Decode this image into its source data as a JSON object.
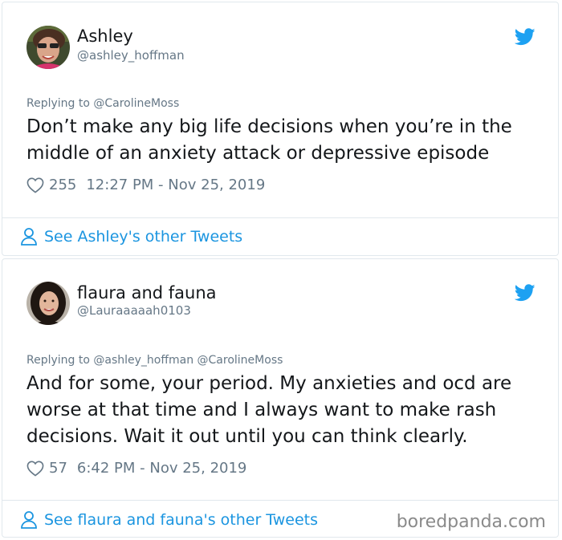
{
  "colors": {
    "text": "#14171a",
    "secondary": "#657786",
    "link": "#1b95e0",
    "twitter_blue": "#1da1f2",
    "border": "#e1e8ed"
  },
  "tweets": [
    {
      "name": "Ashley",
      "handle": "@ashley_hoffman",
      "replying_to": "Replying to @CarolineMoss",
      "text": "Don’t make any big life decisions when you’re in the middle of an anxiety attack or depressive episode",
      "likes": "255",
      "timestamp": "12:27 PM - Nov 25, 2019",
      "see_more": "See Ashley's other Tweets"
    },
    {
      "name": "flaura and fauna",
      "handle": "@Lauraaaaah0103",
      "replying_to": "Replying to @ashley_hoffman @CarolineMoss",
      "text": "And for some, your period. My anxieties and ocd are worse at that time and I always want to make rash decisions. Wait it out until you can think clearly.",
      "likes": "57",
      "timestamp": "6:42 PM - Nov 25, 2019",
      "see_more": "See flaura and fauna's other Tweets"
    }
  ],
  "watermark": "boredpanda.com"
}
